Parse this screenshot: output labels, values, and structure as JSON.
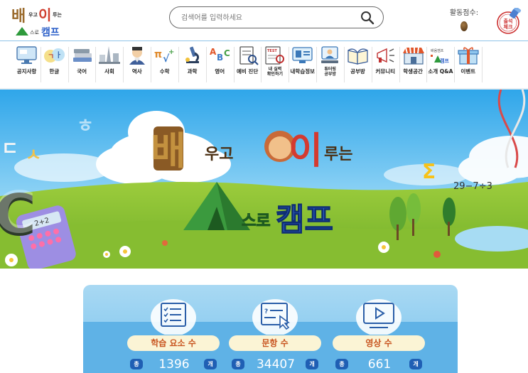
{
  "header": {
    "logo": {
      "line1_big_a": "배",
      "line1_small": "우고",
      "line1_big_b": "이",
      "line1_small_b": "루는",
      "line2_small": "스로",
      "line2_big": "캠프"
    },
    "search": {
      "placeholder": "검색어를 입력하세요"
    },
    "score_label": "활동점수:",
    "stamp_text": "출석\n체크"
  },
  "nav": {
    "items": [
      {
        "label": "공지사항",
        "icon": "monitor-notice-icon"
      },
      {
        "label": "한글",
        "icon": "hangul-letters-icon"
      },
      {
        "label": "국어",
        "icon": "books-stack-icon"
      },
      {
        "label": "사회",
        "icon": "city-landmark-icon"
      },
      {
        "label": "역사",
        "icon": "historical-figure-icon"
      },
      {
        "label": "수학",
        "icon": "math-symbols-icon"
      },
      {
        "label": "과학",
        "icon": "microscope-icon"
      },
      {
        "label": "영어",
        "icon": "english-letters-icon"
      },
      {
        "label": "예비 진단",
        "icon": "diagnosis-document-icon"
      },
      {
        "label": "내 실력\n확인하기",
        "icon": "test-magnifier-icon"
      },
      {
        "label": "내학습정보",
        "icon": "learning-monitor-icon"
      },
      {
        "label": "튜터링\n공부방",
        "icon": "tutoring-screen-icon"
      },
      {
        "label": "공부방",
        "icon": "open-book-icon"
      },
      {
        "label": "커뮤니티",
        "icon": "megaphone-icon"
      },
      {
        "label": "학생공간",
        "icon": "store-front-icon"
      },
      {
        "label": "소개 Q&A",
        "icon": "camp-intro-icon"
      },
      {
        "label": "이벤트",
        "icon": "gift-box-icon"
      }
    ]
  },
  "banner": {
    "title_big_a": "배",
    "title_small_a": "우고",
    "title_big_b": "이",
    "title_small_b": "루는",
    "title_small_c": "스로",
    "title_big_c": "캠프",
    "equation": "29−7÷3",
    "calculator_display": "2+2",
    "floating_letters": [
      "ㄷ",
      "ㅅ",
      "ㅎ",
      "C",
      "Σ"
    ]
  },
  "stats": [
    {
      "label": "학습 요소 수",
      "prefix": "총",
      "value": "1396",
      "suffix": "개",
      "icon": "checklist-icon"
    },
    {
      "label": "문항 수",
      "prefix": "총",
      "value": "34407",
      "suffix": "개",
      "icon": "question-click-icon"
    },
    {
      "label": "영상 수",
      "prefix": "총",
      "value": "661",
      "suffix": "개",
      "icon": "video-play-icon"
    }
  ],
  "colors": {
    "accent_blue": "#2a5ec8",
    "stats_bg": "#5fb2e6",
    "pill_bg": "#fbf4d5",
    "pill_text": "#c8541f",
    "chip_blue": "#1f5fb4"
  }
}
